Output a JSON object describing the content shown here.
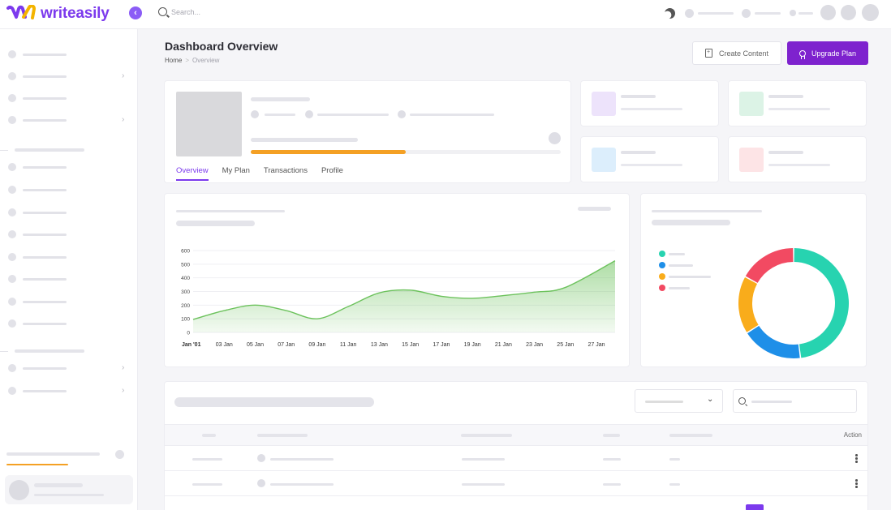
{
  "brand": {
    "name": "writeasily",
    "accent": "#7c3aed"
  },
  "search": {
    "placeholder": "Search..."
  },
  "header": {
    "title": "Dashboard Overview",
    "breadcrumb": {
      "home": "Home",
      "separator": ">",
      "current": "Overview"
    },
    "create_label": "Create Content",
    "upgrade_label": "Upgrade Plan"
  },
  "profile": {
    "progress_fraction": 0.5,
    "progress_color": "#f4a024",
    "tabs": [
      {
        "label": "Overview",
        "active": true
      },
      {
        "label": "My Plan",
        "active": false
      },
      {
        "label": "Transactions",
        "active": false
      },
      {
        "label": "Profile",
        "active": false
      }
    ]
  },
  "stat_cards": [
    {
      "color": "#ede3fb"
    },
    {
      "color": "#dcf3e6"
    },
    {
      "color": "#dceefc"
    },
    {
      "color": "#fde4e6"
    }
  ],
  "chart_data": [
    {
      "type": "area",
      "x": [
        "Jan '01",
        "03 Jan",
        "05 Jan",
        "07 Jan",
        "09 Jan",
        "11 Jan",
        "13 Jan",
        "15 Jan",
        "17 Jan",
        "19 Jan",
        "21 Jan",
        "23 Jan",
        "25 Jan",
        "27 Jan"
      ],
      "series": [
        {
          "values": [
            95,
            160,
            200,
            160,
            100,
            190,
            290,
            310,
            265,
            250,
            270,
            295,
            330,
            525
          ]
        }
      ],
      "yticks": [
        0,
        100,
        200,
        300,
        400,
        500,
        600
      ],
      "ylim": [
        0,
        600
      ],
      "color": "#6cc25c",
      "grid": true
    },
    {
      "type": "pie",
      "variant": "donut",
      "slices": [
        {
          "value": 48,
          "color": "#27d3b0"
        },
        {
          "value": 18,
          "color": "#1e8fe8"
        },
        {
          "value": 17,
          "color": "#f9ac1b"
        },
        {
          "value": 17,
          "color": "#f24a62"
        }
      ]
    }
  ],
  "table": {
    "action_header": "Action",
    "row_count": 2
  }
}
